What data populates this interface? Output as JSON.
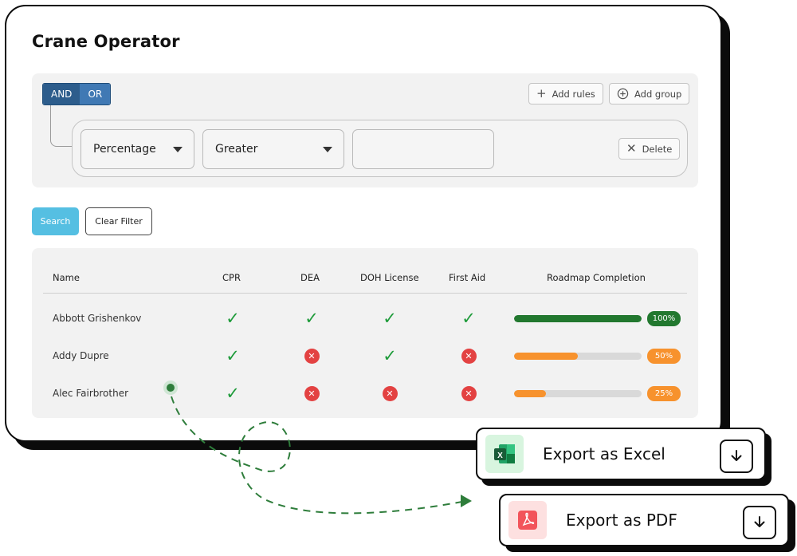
{
  "page": {
    "title": "Crane Operator"
  },
  "filter": {
    "logic": [
      {
        "label": "AND",
        "active": true
      },
      {
        "label": "OR",
        "active": false
      }
    ],
    "add_rules_label": "Add rules",
    "add_group_label": "Add group",
    "rule": {
      "field": "Percentage",
      "operator": "Greater",
      "value": "",
      "delete_label": "Delete"
    }
  },
  "actions": {
    "search_label": "Search",
    "clear_label": "Clear Filter"
  },
  "table": {
    "headers": [
      "Name",
      "CPR",
      "DEA",
      "DOH License",
      "First Aid",
      "Roadmap Completion"
    ],
    "rows": [
      {
        "name": "Abbott Grishenkov",
        "cpr": "check",
        "dea": "check",
        "doh": "check",
        "first_aid": "check",
        "completion": 100,
        "completion_label": "100%"
      },
      {
        "name": "Addy Dupre",
        "cpr": "check",
        "dea": "cross",
        "doh": "check",
        "first_aid": "cross",
        "completion": 50,
        "completion_label": "50%"
      },
      {
        "name": "Alec Fairbrother",
        "cpr": "check",
        "dea": "cross",
        "doh": "cross",
        "first_aid": "cross",
        "completion": 25,
        "completion_label": "25%"
      }
    ]
  },
  "exports": {
    "excel_label": "Export as Excel",
    "pdf_label": "Export as PDF"
  },
  "colors": {
    "complete": "#22782f",
    "partial": "#f7922d",
    "check": "#1e9b3a",
    "cross": "#e34242",
    "logic_active": "#2d5d8c",
    "search": "#55bfe2"
  },
  "icons": {
    "check": "check-icon",
    "cross": "cross-circle-icon",
    "excel": "excel-icon",
    "pdf": "pdf-icon",
    "download": "download-icon"
  }
}
